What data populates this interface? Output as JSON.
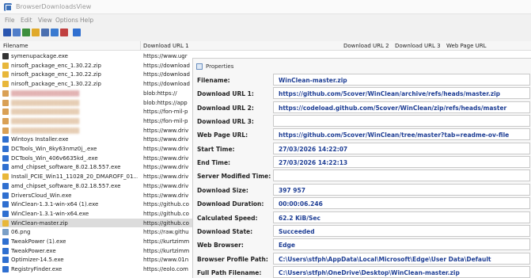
{
  "window": {
    "title": "BrowserDownloadsView"
  },
  "menu": [
    "File",
    "Edit",
    "View",
    "Options",
    "Help"
  ],
  "toolbar": {
    "buttons": [
      {
        "icon": "save-icon",
        "color": "#2a56b0"
      },
      {
        "icon": "copy-icon",
        "color": "#4f7dc9"
      },
      {
        "icon": "html-report-icon",
        "color": "#3d8f3d"
      },
      {
        "icon": "open-folder-icon",
        "color": "#e0a92a"
      },
      {
        "icon": "properties-icon",
        "color": "#4a6fb0"
      },
      {
        "icon": "refresh-icon",
        "color": "#3a7ad0"
      },
      {
        "icon": "sort-icon",
        "color": "#c04040"
      },
      {
        "icon": "exit-icon",
        "color": "#2f6fd0"
      }
    ]
  },
  "list": {
    "columns": {
      "filename": "Filename",
      "download_url_1": "Download URL 1",
      "download_url_2": "Download URL 2",
      "download_url_3": "Download URL 3",
      "web_page_url": "Web Page URL"
    },
    "rows": [
      {
        "filename": "symenupackage.exe",
        "url": "https://www.ugr",
        "icon": "pkg",
        "blur": 0
      },
      {
        "filename": "nirsoft_package_enc_1.30.22.zip",
        "url": "https://download",
        "icon": "zip",
        "blur": 0
      },
      {
        "filename": "nirsoft_package_enc_1.30.22.zip",
        "url": "https://download",
        "icon": "zip",
        "blur": 0
      },
      {
        "filename": "nirsoft_package_enc_1.30.22.zip",
        "url": "https://download",
        "icon": "zip",
        "blur": 0
      },
      {
        "filename": "",
        "url": "blob:https://",
        "icon": "blur",
        "blur": 1
      },
      {
        "filename": "",
        "url": "blob:https://app",
        "icon": "blur",
        "blur": 2
      },
      {
        "filename": "",
        "url": "https://fon-mil-p",
        "icon": "blur",
        "blur": 2
      },
      {
        "filename": "",
        "url": "https://fon-mil-p",
        "icon": "blur",
        "blur": 2
      },
      {
        "filename": "",
        "url": "https://www.driv",
        "icon": "blur",
        "blur": 2
      },
      {
        "filename": "Wintoys Installer.exe",
        "url": "https://www.driv",
        "icon": "exe",
        "blur": 0
      },
      {
        "filename": "DCTools_Win_8ky63nmz0j_.exe",
        "url": "https://www.driv",
        "icon": "exe",
        "blur": 0
      },
      {
        "filename": "DCTools_Win_406v6635kd_.exe",
        "url": "https://www.driv",
        "icon": "exe",
        "blur": 0
      },
      {
        "filename": "amd_chipset_software_8.02.18.557.exe",
        "url": "https://www.driv",
        "icon": "exe",
        "blur": 0
      },
      {
        "filename": "Install_PCIE_Win11_11028_20_DMAROFF_01...",
        "url": "https://www.driv",
        "icon": "zip",
        "blur": 0
      },
      {
        "filename": "amd_chipset_software_8.02.18.557.exe",
        "url": "https://www.driv",
        "icon": "exe",
        "blur": 0
      },
      {
        "filename": "DriversCloud_Win.exe",
        "url": "https://www.driv",
        "icon": "exe",
        "blur": 0
      },
      {
        "filename": "WinClean-1.3.1-win-x64 (1).exe",
        "url": "https://github.co",
        "icon": "exe",
        "blur": 0
      },
      {
        "filename": "WinClean-1.3.1-win-x64.exe",
        "url": "https://github.co",
        "icon": "exe",
        "blur": 0
      },
      {
        "filename": "WinClean-master.zip",
        "url": "https://github.co",
        "icon": "zip",
        "blur": 0,
        "selected": true
      },
      {
        "filename": "06.png",
        "url": "https://raw.githu",
        "icon": "png",
        "blur": 0
      },
      {
        "filename": "TweakPower (1).exe",
        "url": "https://kurtzimm",
        "icon": "exe",
        "blur": 0
      },
      {
        "filename": "TweakPower.exe",
        "url": "https://kurtzimm",
        "icon": "exe",
        "blur": 0
      },
      {
        "filename": "Optimizer-14.5.exe",
        "url": "https://www.01n",
        "icon": "exe",
        "blur": 0
      },
      {
        "filename": "RegistryFinder.exe",
        "url": "https://eolo.com",
        "icon": "exe",
        "blur": 0
      }
    ]
  },
  "properties": {
    "title": "Properties",
    "fields": [
      {
        "label": "Filename:",
        "value": "WinClean-master.zip"
      },
      {
        "label": "Download URL 1:",
        "value": "https://github.com/5cover/WinClean/archive/refs/heads/master.zip"
      },
      {
        "label": "Download URL 2:",
        "value": "https://codeload.github.com/5cover/WinClean/zip/refs/heads/master"
      },
      {
        "label": "Download URL 3:",
        "value": ""
      },
      {
        "label": "Web Page URL:",
        "value": "https://github.com/5cover/WinClean/tree/master?tab=readme-ov-file"
      },
      {
        "label": "Start Time:",
        "value": "27/03/2026 14:22:07"
      },
      {
        "label": "End Time:",
        "value": "27/03/2026 14:22:13"
      },
      {
        "label": "Server Modified Time:",
        "value": ""
      },
      {
        "label": "Download Size:",
        "value": "397 957"
      },
      {
        "label": "Download Duration:",
        "value": "00:00:06.246"
      },
      {
        "label": "Calculated Speed:",
        "value": "62.2 KiB/Sec"
      },
      {
        "label": "Download State:",
        "value": "Succeeded"
      },
      {
        "label": "Web Browser:",
        "value": "Edge"
      },
      {
        "label": "Browser Profile Path:",
        "value": "C:\\Users\\stfph\\AppData\\Local\\Microsoft\\Edge\\User Data\\Default"
      },
      {
        "label": "Full Path Filename:",
        "value": "C:\\Users\\stfph\\OneDrive\\Desktop\\WinClean-master.zip"
      }
    ]
  }
}
